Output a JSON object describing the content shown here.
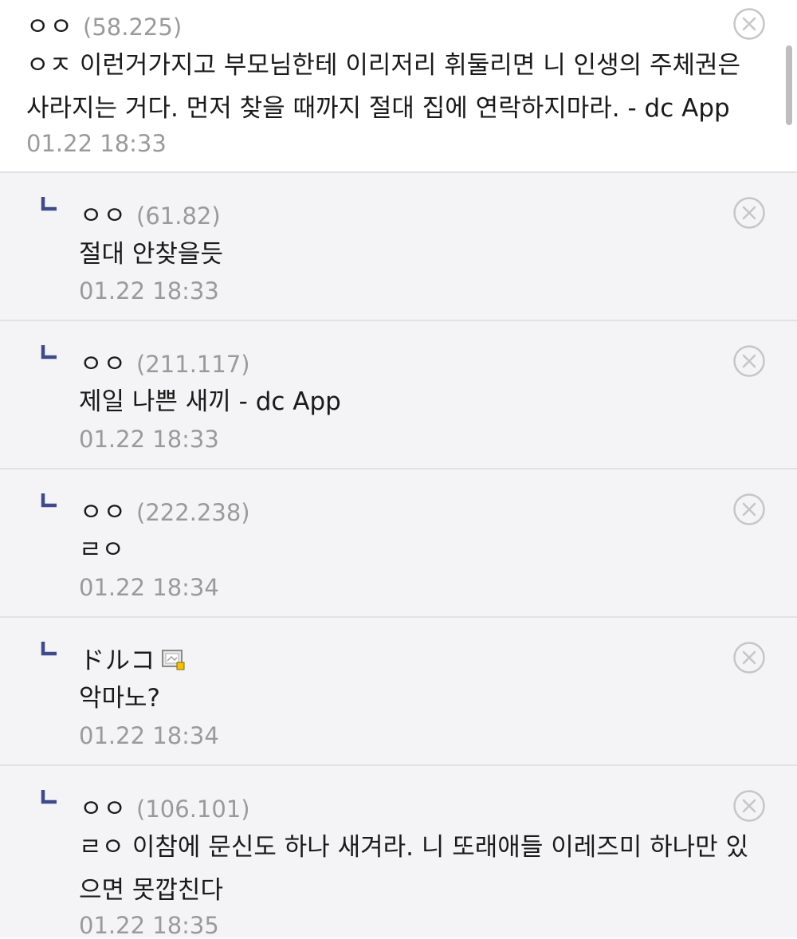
{
  "colors": {
    "reply_background": "#f4f4f6",
    "reply_arrow": "#3f4a8a",
    "meta_text": "#9a9a9a"
  },
  "comments": [
    {
      "nick": "ㅇㅇ",
      "ip": "(58.225)",
      "lines": [
        "ㅇㅈ 이런거가지고 부모님한테 이리저리 휘둘리면 니 인생의 주체권은",
        "사라지는 거다. 먼저 찾을 때까지 절대 집에 연락하지마라. - dc App"
      ],
      "time": "01.22 18:33",
      "delete_icon": "circle-x-icon"
    },
    {
      "nick": "ㅇㅇ",
      "ip": "(61.82)",
      "lines": [
        "절대 안찾을듯"
      ],
      "time": "01.22 18:33",
      "reply_icon": "reply-arrow-icon",
      "delete_icon": "circle-x-icon"
    },
    {
      "nick": "ㅇㅇ",
      "ip": "(211.117)",
      "lines": [
        "제일 나쁜 새끼 - dc App"
      ],
      "time": "01.22 18:33",
      "reply_icon": "reply-arrow-icon",
      "delete_icon": "circle-x-icon"
    },
    {
      "nick": "ㅇㅇ",
      "ip": "(222.238)",
      "lines": [
        "ㄹㅇ"
      ],
      "time": "01.22 18:34",
      "reply_icon": "reply-arrow-icon",
      "delete_icon": "circle-x-icon"
    },
    {
      "nick": "ドルコ",
      "ip": "",
      "badge_icon": "gallery-member-icon",
      "lines": [
        "악마노?"
      ],
      "time": "01.22 18:34",
      "reply_icon": "reply-arrow-icon",
      "delete_icon": "circle-x-icon"
    },
    {
      "nick": "ㅇㅇ",
      "ip": "(106.101)",
      "lines": [
        "ㄹㅇ 이참에 문신도 하나 새겨라. 니 또래애들 이레즈미 하나만 있",
        "으면 못깝친다"
      ],
      "time": "01.22 18:35",
      "reply_icon": "reply-arrow-icon",
      "delete_icon": "circle-x-icon"
    }
  ]
}
